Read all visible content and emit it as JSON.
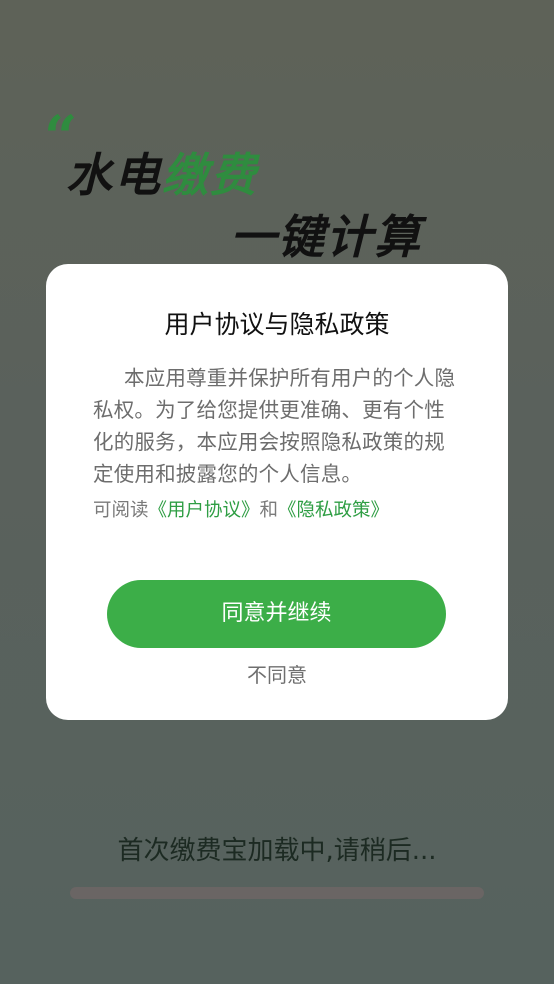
{
  "splash": {
    "quote_mark": "“",
    "headline_part1": "水电",
    "headline_part1_accent": "缴费",
    "headline_part2": "一键计算",
    "loading_text": "首次缴费宝加载中,请稍后...",
    "progress": 0
  },
  "dialog": {
    "title": "用户协议与隐私政策",
    "body": "本应用尊重并保护所有用户的个人隐私权。为了给您提供更准确、更有个性化的服务，本应用会按照隐私政策的规定使用和披露您的个人信息。",
    "links_prefix": "可阅读",
    "user_agreement_link": "《用户协议》",
    "links_conjunction": "和",
    "privacy_policy_link": "《隐私政策》",
    "agree_button": "同意并继续",
    "disagree_button": "不同意"
  },
  "colors": {
    "accent_green": "#3cae48",
    "link_green": "#2f9e44",
    "headline_green": "#2f8c3f"
  }
}
